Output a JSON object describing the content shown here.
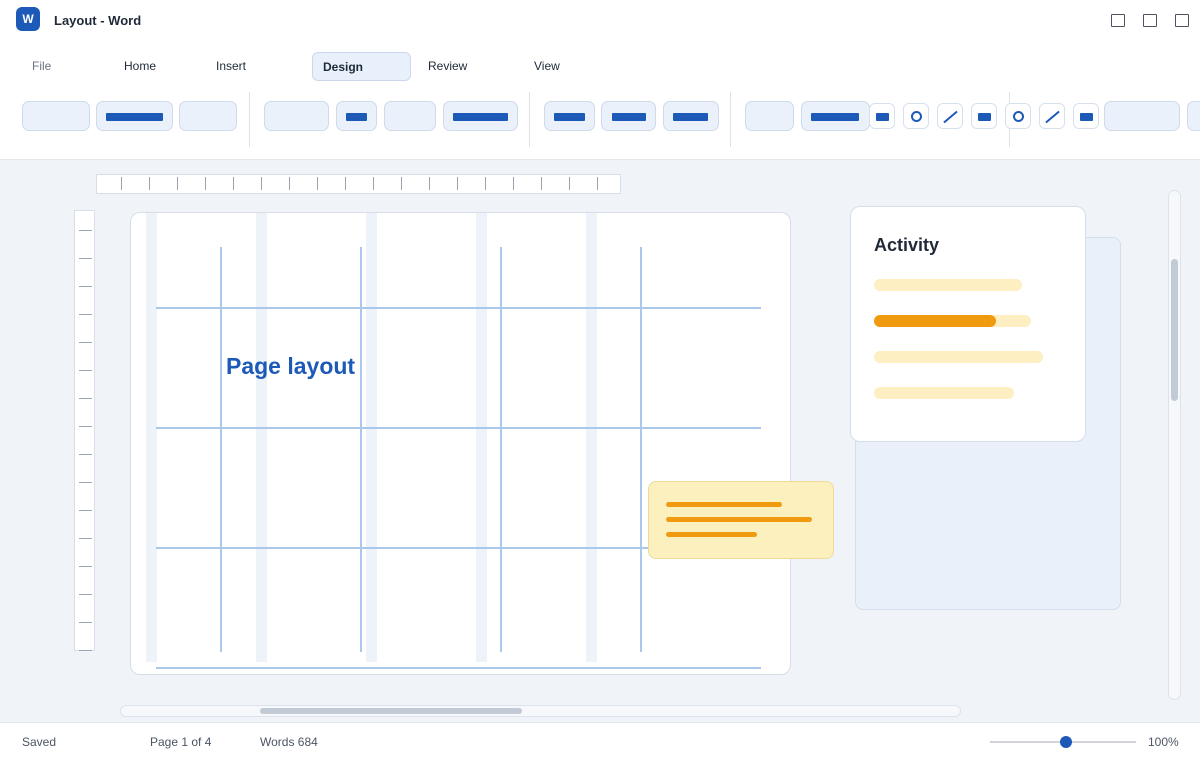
{
  "window": {
    "app_icon_letter": "W",
    "title": "Layout - Word",
    "controls": [
      "minimize-icon",
      "maximize-icon",
      "close-icon"
    ]
  },
  "ribbon": {
    "tabs": [
      {
        "label": "File",
        "active": false
      },
      {
        "label": "Home",
        "active": false
      },
      {
        "label": "Insert",
        "active": false
      },
      {
        "label": "Design",
        "active": true
      },
      {
        "label": "Review",
        "active": false
      },
      {
        "label": "View",
        "active": false
      }
    ],
    "shape_icons": [
      "rectangle-icon",
      "circle-icon",
      "line-icon",
      "rectangle-icon",
      "circle-icon",
      "line-icon",
      "rectangle-icon"
    ]
  },
  "document": {
    "heading": "Page layout"
  },
  "activity": {
    "title": "Activity",
    "items": [
      {
        "progress": 0
      },
      {
        "progress": 0.78
      },
      {
        "progress": 0
      },
      {
        "progress": 0
      }
    ]
  },
  "status": {
    "saved": "Saved",
    "page": "Page 1 of 4",
    "words": "Words 684",
    "zoom": "100%",
    "zoom_level": 0.52
  },
  "colors": {
    "accent": "#1d5ab8",
    "highlight": "#ef9a0f",
    "note_bg": "#fdf0bf",
    "grid": "#a9c8ec"
  }
}
